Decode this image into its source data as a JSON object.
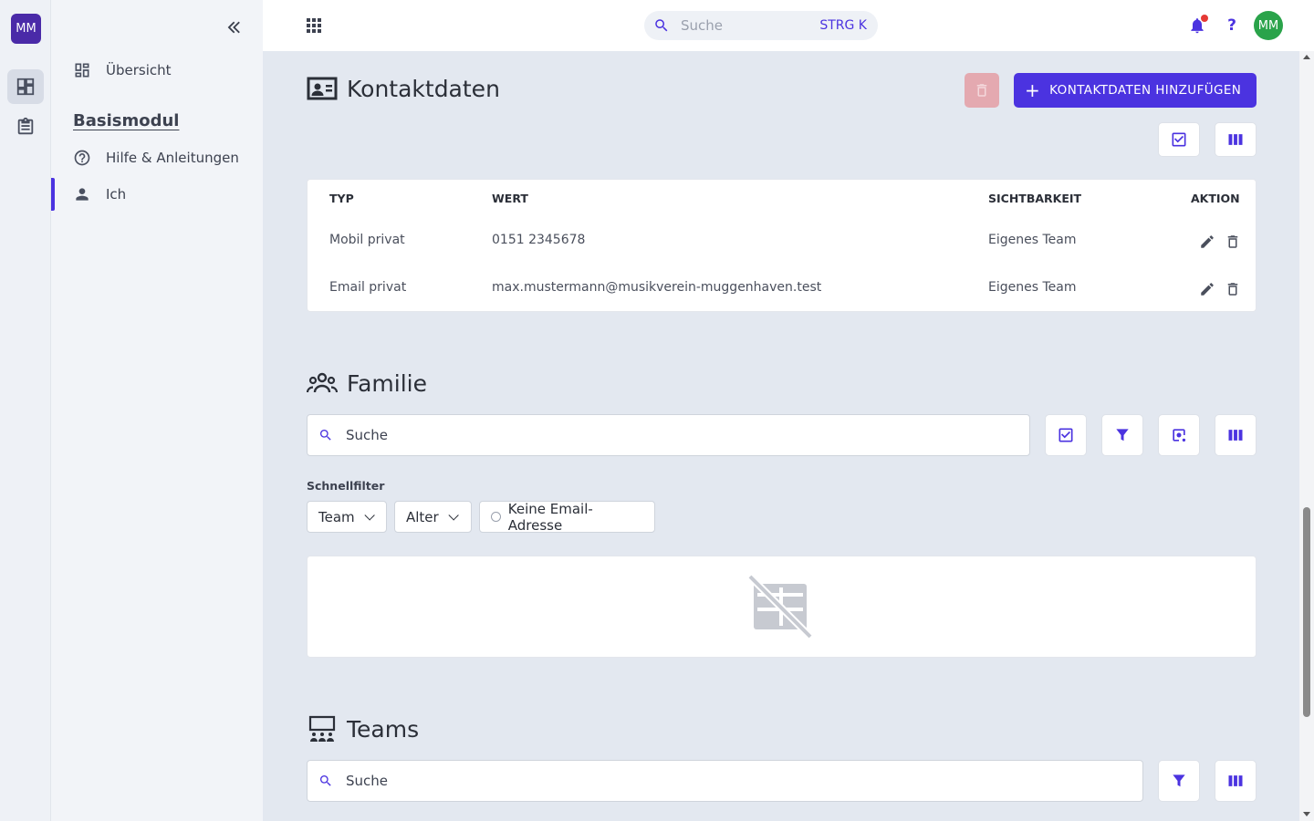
{
  "user": {
    "initials": "MM"
  },
  "sidebar": {
    "overview_label": "Übersicht",
    "section_title": "Basismodul",
    "items": [
      {
        "label": "Hilfe & Anleitungen",
        "icon": "help-circle-icon"
      },
      {
        "label": "Ich",
        "icon": "person-icon",
        "active": true
      }
    ]
  },
  "topbar": {
    "search_placeholder": "Suche",
    "search_shortcut": "STRG K",
    "help_label": "?"
  },
  "kontaktdaten": {
    "title": "Kontaktdaten",
    "add_label": "KONTAKTDATEN HINZUFÜGEN",
    "columns": [
      "TYP",
      "WERT",
      "SICHTBARKEIT",
      "AKTION"
    ],
    "rows": [
      {
        "typ": "Mobil privat",
        "wert": "0151 2345678",
        "sichtbarkeit": "Eigenes Team"
      },
      {
        "typ": "Email privat",
        "wert": "max.mustermann@musikverein-muggenhaven.test",
        "sichtbarkeit": "Eigenes Team"
      }
    ]
  },
  "familie": {
    "title": "Familie",
    "search_placeholder": "Suche",
    "quickfilter_label": "Schnellfilter",
    "filters": [
      "Team",
      "Alter",
      "Keine Email-Adresse"
    ]
  },
  "teams": {
    "title": "Teams",
    "search_placeholder": "Suche"
  },
  "colors": {
    "accent": "#4b33e0",
    "user_avatar": "#2aa34a",
    "rail_avatar": "#4a2aa8",
    "danger_disabled": "#e4a9b0"
  }
}
